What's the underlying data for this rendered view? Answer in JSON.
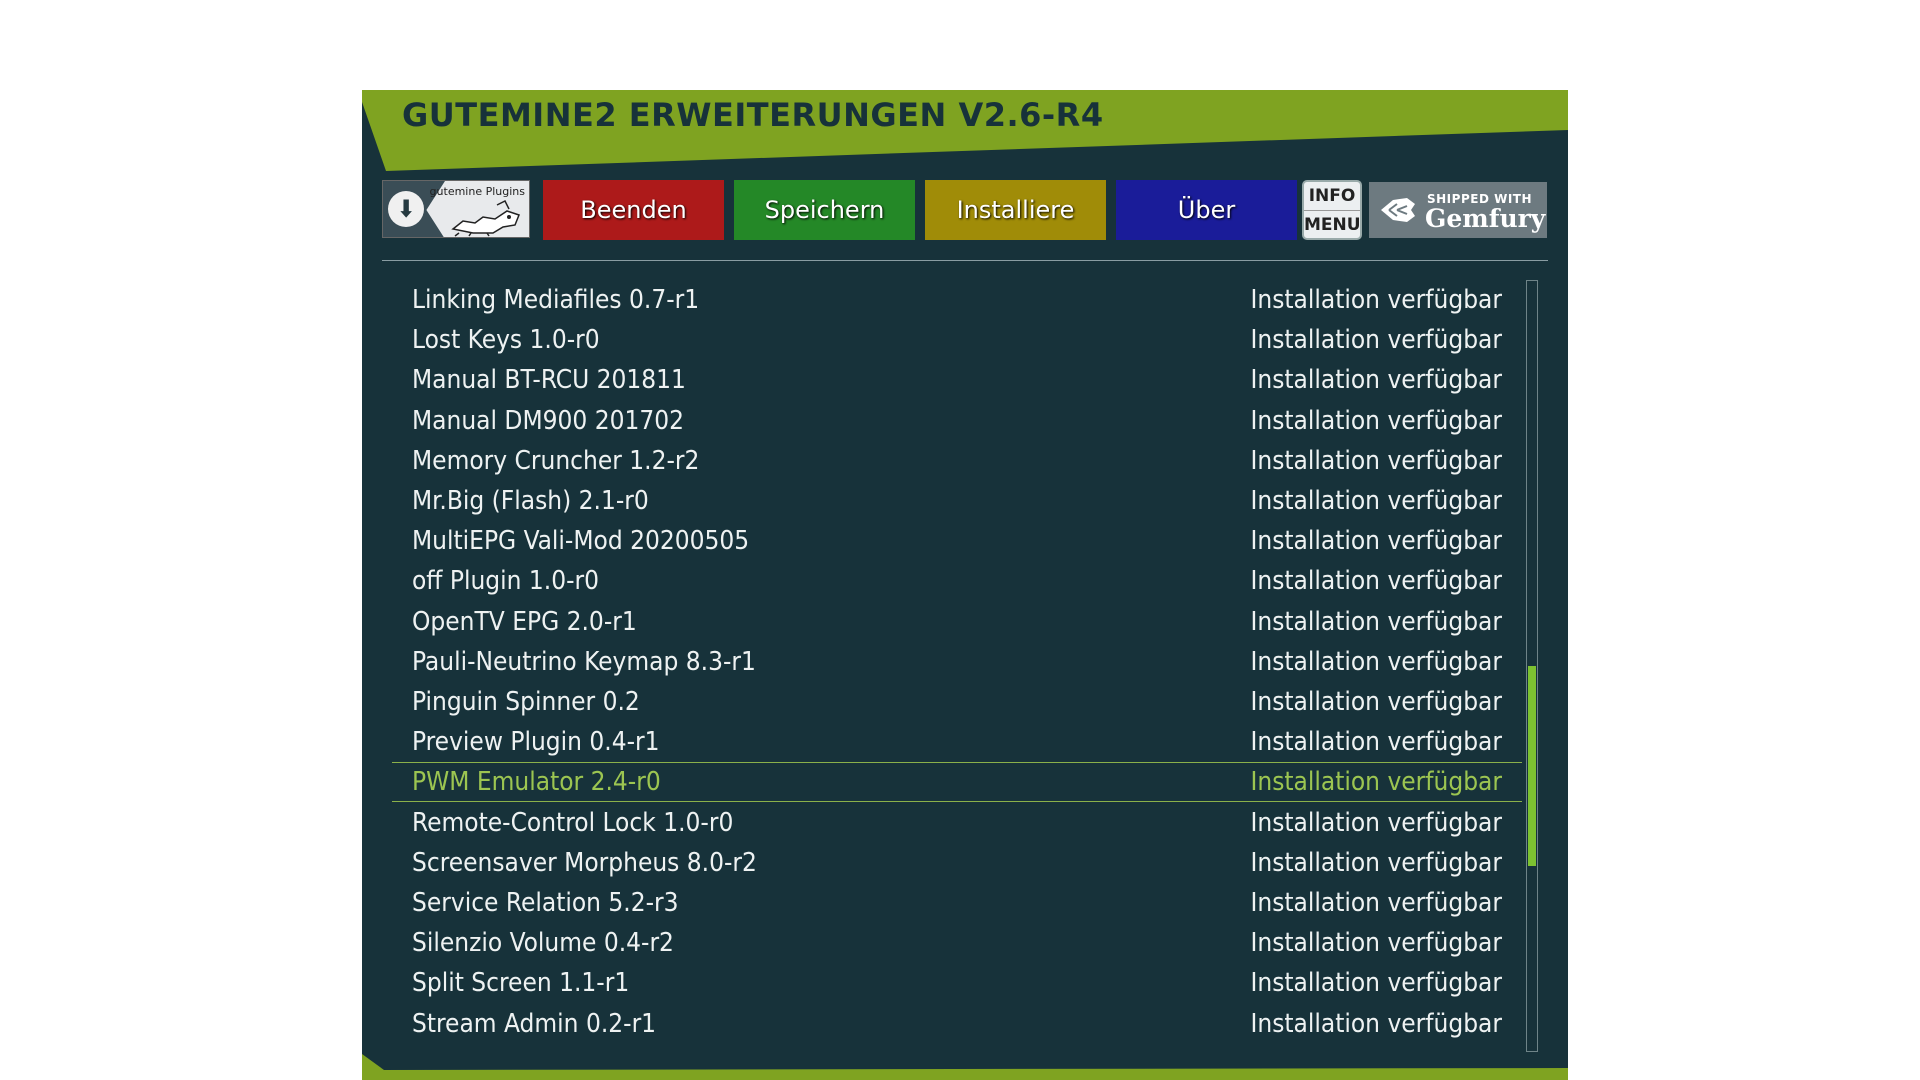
{
  "header": {
    "title": "GUTEMINE2 ERWEITERUNGEN V2.6-R4"
  },
  "toolbar": {
    "logo_text": "gutemine Plugins",
    "red_label": "Beenden",
    "green_label": "Speichern",
    "yellow_label": "Installiere",
    "blue_label": "Über",
    "info_label": "INFO",
    "menu_label": "MENU",
    "gemfury_small": "SHIPPED WITH",
    "gemfury_big": "Gemfury"
  },
  "list": {
    "selected_index": 12,
    "items": [
      {
        "name": "Linking Mediafiles 0.7-r1",
        "status": "Installation verfügbar"
      },
      {
        "name": "Lost Keys 1.0-r0",
        "status": "Installation verfügbar"
      },
      {
        "name": "Manual BT-RCU 201811",
        "status": "Installation verfügbar"
      },
      {
        "name": "Manual DM900 201702",
        "status": "Installation verfügbar"
      },
      {
        "name": "Memory Cruncher 1.2-r2",
        "status": "Installation verfügbar"
      },
      {
        "name": "Mr.Big (Flash) 2.1-r0",
        "status": "Installation verfügbar"
      },
      {
        "name": "MultiEPG Vali-Mod 20200505",
        "status": "Installation verfügbar"
      },
      {
        "name": "off Plugin 1.0-r0",
        "status": "Installation verfügbar"
      },
      {
        "name": "OpenTV EPG 2.0-r1",
        "status": "Installation verfügbar"
      },
      {
        "name": "Pauli-Neutrino Keymap 8.3-r1",
        "status": "Installation verfügbar"
      },
      {
        "name": "Pinguin Spinner 0.2",
        "status": "Installation verfügbar"
      },
      {
        "name": "Preview Plugin 0.4-r1",
        "status": "Installation verfügbar"
      },
      {
        "name": "PWM Emulator 2.4-r0",
        "status": "Installation verfügbar"
      },
      {
        "name": "Remote-Control Lock 1.0-r0",
        "status": "Installation verfügbar"
      },
      {
        "name": "Screensaver Morpheus 8.0-r2",
        "status": "Installation verfügbar"
      },
      {
        "name": "Service Relation 5.2-r3",
        "status": "Installation verfügbar"
      },
      {
        "name": "Silenzio Volume 0.4-r2",
        "status": "Installation verfügbar"
      },
      {
        "name": "Split Screen 1.1-r1",
        "status": "Installation verfügbar"
      },
      {
        "name": "Stream Admin 0.2-r1",
        "status": "Installation verfügbar"
      }
    ]
  },
  "scrollbar": {
    "thumb_start": 0.5,
    "thumb_end": 0.76
  },
  "colors": {
    "background": "#17323a",
    "accent_green": "#7fa321",
    "selected_text": "#9cc551",
    "red": "#ad1a1a",
    "green": "#248827",
    "yellow": "#a08c08",
    "blue": "#1a1c99"
  }
}
